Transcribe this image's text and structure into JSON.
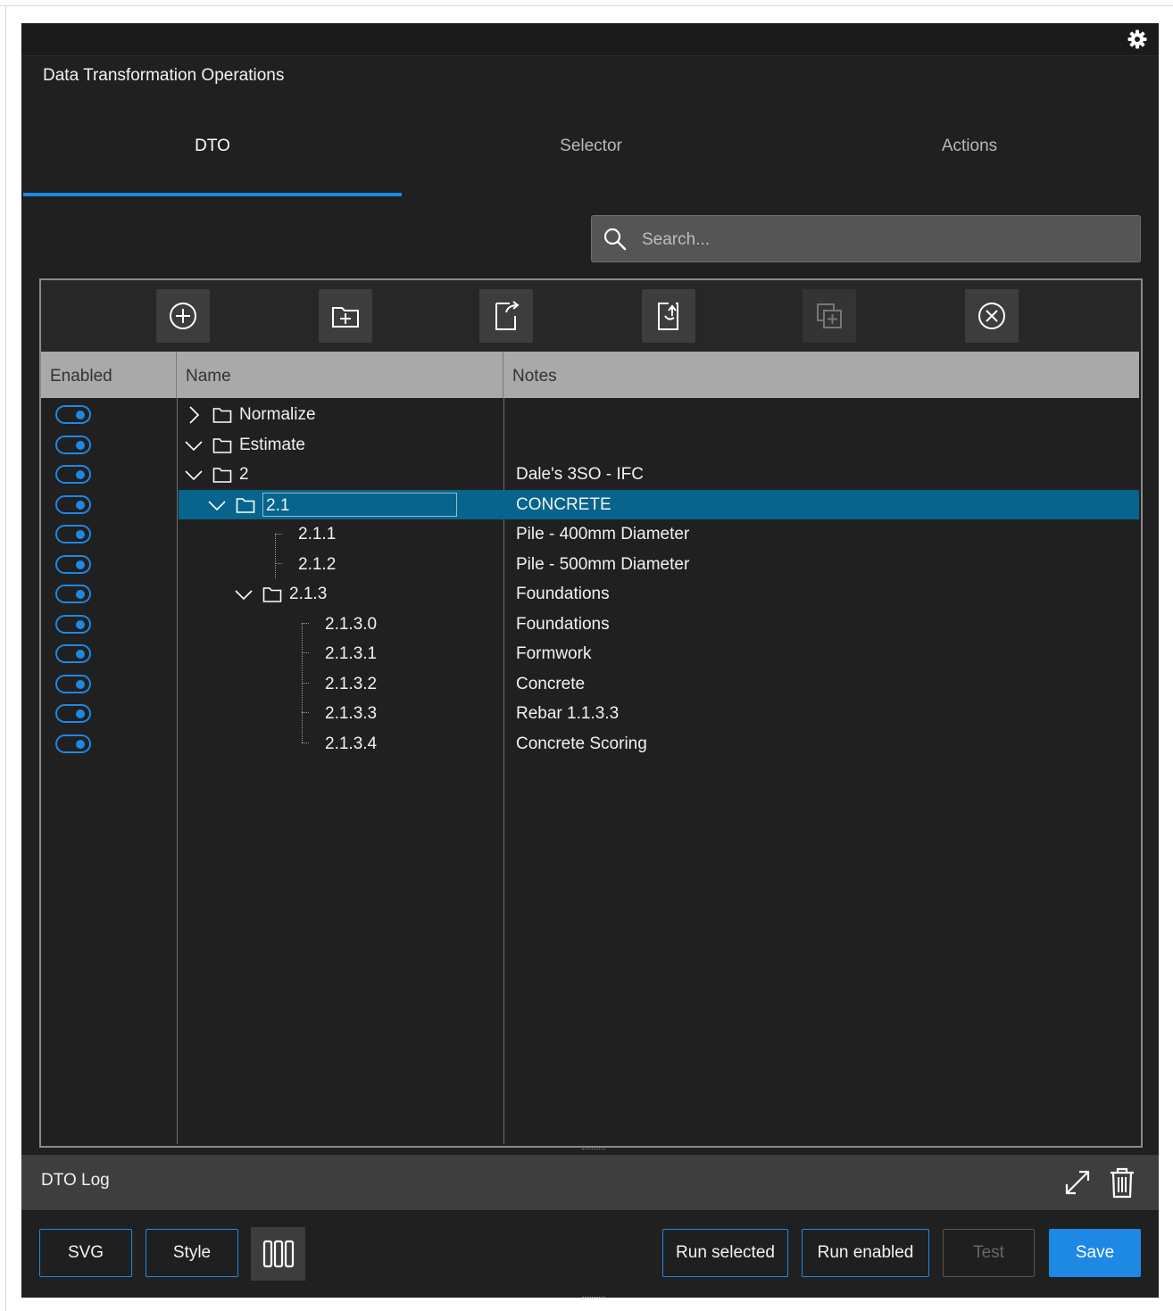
{
  "window": {
    "title": "Data Transformation Operations"
  },
  "tabs": [
    {
      "label": "DTO",
      "active": true
    },
    {
      "label": "Selector",
      "active": false
    },
    {
      "label": "Actions",
      "active": false
    }
  ],
  "search": {
    "placeholder": "Search..."
  },
  "toolbar": {
    "buttons": [
      {
        "icon": "add-circle-icon"
      },
      {
        "icon": "new-folder-icon"
      },
      {
        "icon": "export-icon"
      },
      {
        "icon": "import-icon"
      },
      {
        "icon": "duplicate-icon",
        "disabled": true
      },
      {
        "icon": "delete-circle-icon"
      }
    ]
  },
  "table": {
    "headers": {
      "enabled": "Enabled",
      "name": "Name",
      "notes": "Notes"
    },
    "rows": [
      {
        "name": "Normalize",
        "notes": "",
        "enabled": true,
        "folder": true,
        "expanded": false,
        "level": 0
      },
      {
        "name": "Estimate",
        "notes": "",
        "enabled": true,
        "folder": true,
        "expanded": true,
        "level": 0
      },
      {
        "name": "2",
        "notes": "Dale's 3SO - IFC",
        "enabled": true,
        "folder": true,
        "expanded": true,
        "level": 1
      },
      {
        "name": "2.1",
        "notes": "CONCRETE",
        "enabled": true,
        "folder": true,
        "expanded": true,
        "level": 2,
        "selected": true
      },
      {
        "name": "2.1.1",
        "notes": "Pile - 400mm Diameter",
        "enabled": true,
        "folder": false,
        "level": 3
      },
      {
        "name": "2.1.2",
        "notes": "Pile - 500mm Diameter",
        "enabled": true,
        "folder": false,
        "level": 3
      },
      {
        "name": "2.1.3",
        "notes": "Foundations",
        "enabled": true,
        "folder": true,
        "expanded": true,
        "level": 3
      },
      {
        "name": "2.1.3.0",
        "notes": "Foundations",
        "enabled": true,
        "folder": false,
        "level": 4
      },
      {
        "name": "2.1.3.1",
        "notes": "Formwork",
        "enabled": true,
        "folder": false,
        "level": 4
      },
      {
        "name": "2.1.3.2",
        "notes": "Concrete",
        "enabled": true,
        "folder": false,
        "level": 4
      },
      {
        "name": "2.1.3.3",
        "notes": "Rebar 1.1.3.3",
        "enabled": true,
        "folder": false,
        "level": 4
      },
      {
        "name": "2.1.3.4",
        "notes": "Concrete Scoring",
        "enabled": true,
        "folder": false,
        "level": 4
      }
    ]
  },
  "log": {
    "title": "DTO Log"
  },
  "footer": {
    "svg_label": "SVG",
    "style_label": "Style",
    "run_selected_label": "Run selected",
    "run_enabled_label": "Run enabled",
    "test_label": "Test",
    "save_label": "Save"
  },
  "colors": {
    "accent": "#1e88e5",
    "selection": "#07648c",
    "background": "#202020",
    "header": "#a9a9a9"
  }
}
